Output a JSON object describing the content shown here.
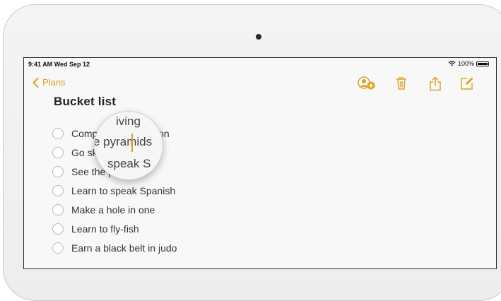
{
  "status_bar": {
    "time": "9:41 AM",
    "date": "Wed Sep 12",
    "battery": "100%"
  },
  "nav": {
    "back_label": "Plans"
  },
  "toolbar": {
    "icons": [
      "add-person-icon",
      "trash-icon",
      "share-icon",
      "compose-icon"
    ],
    "accent": "#e0a020"
  },
  "note": {
    "title": "Bucket list",
    "items": [
      "Comp",
      "Go sky",
      "See the pyramids",
      "Learn to speak Spanish",
      "Make a hole in one",
      "Learn to fly-fish",
      "Earn a black belt in judo"
    ],
    "fragment": "non"
  },
  "magnifier": {
    "line1": "iving",
    "line2": "e pyramids",
    "line3": "speak S"
  }
}
